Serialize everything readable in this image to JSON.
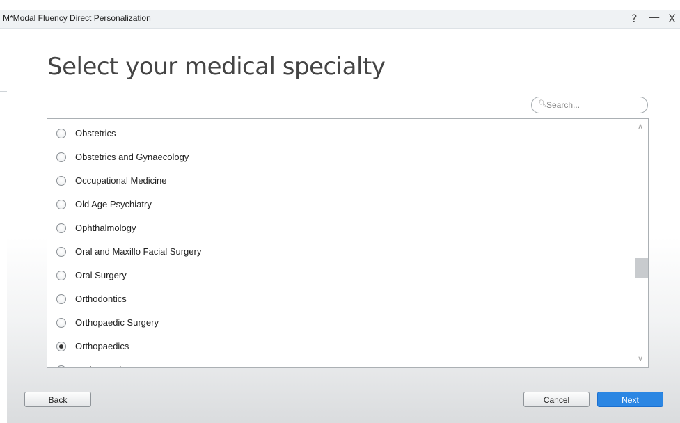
{
  "window": {
    "title": "M*Modal Fluency Direct Personalization",
    "controls": {
      "help": "?",
      "minimize": "—",
      "close": "X"
    }
  },
  "page": {
    "heading": "Select your medical specialty"
  },
  "search": {
    "placeholder": "Search..."
  },
  "specialties": {
    "items": [
      {
        "label": "Obstetrics",
        "selected": false
      },
      {
        "label": "Obstetrics and Gynaecology",
        "selected": false
      },
      {
        "label": "Occupational Medicine",
        "selected": false
      },
      {
        "label": "Old Age Psychiatry",
        "selected": false
      },
      {
        "label": "Ophthalmology",
        "selected": false
      },
      {
        "label": "Oral and Maxillo Facial Surgery",
        "selected": false
      },
      {
        "label": "Oral Surgery",
        "selected": false
      },
      {
        "label": "Orthodontics",
        "selected": false
      },
      {
        "label": "Orthopaedic Surgery",
        "selected": false
      },
      {
        "label": "Orthopaedics",
        "selected": true
      },
      {
        "label": "Otolaryngology",
        "selected": false
      }
    ],
    "selected": "Orthopaedics"
  },
  "buttons": {
    "back": "Back",
    "cancel": "Cancel",
    "next": "Next"
  },
  "colors": {
    "accent": "#2b86e3"
  },
  "icons": {
    "search": "search-icon",
    "scroll_up": "chevron-up-icon",
    "scroll_down": "chevron-down-icon"
  }
}
